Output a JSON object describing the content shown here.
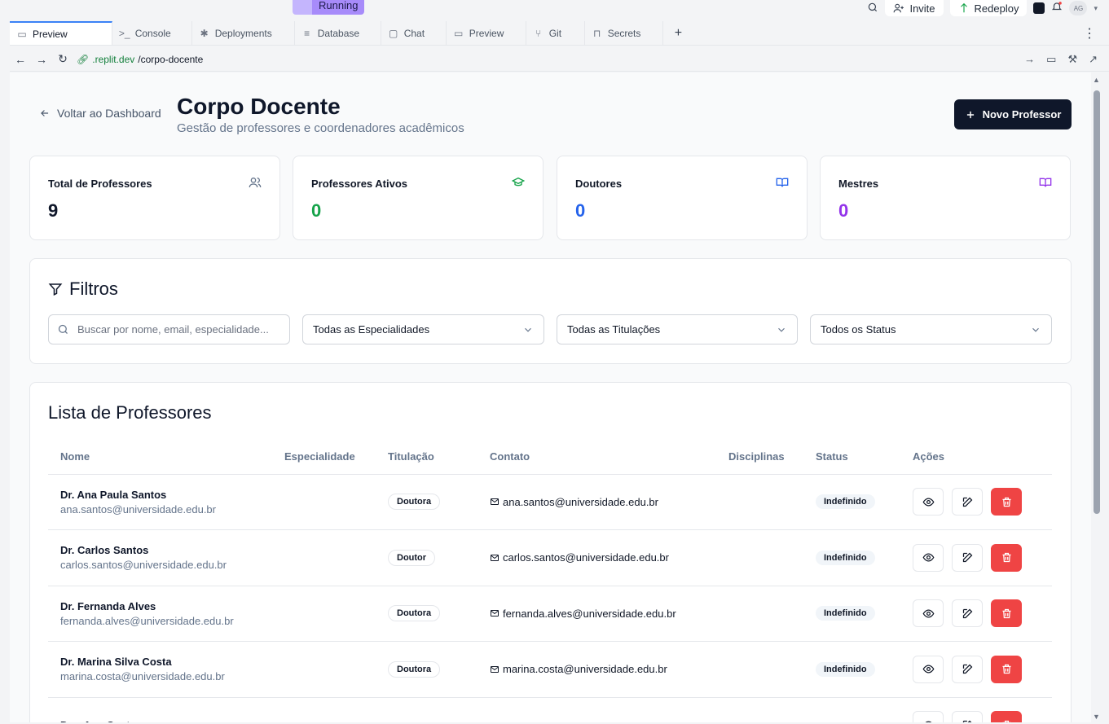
{
  "ide": {
    "status": "Running",
    "invite_label": "Invite",
    "redeploy_label": "Redeploy",
    "avatar_initials": "AG",
    "tabs": [
      {
        "label": "Preview",
        "icon": "monitor-icon",
        "active": true
      },
      {
        "label": "Console",
        "icon": "terminal-icon"
      },
      {
        "label": "Deployments",
        "icon": "deploy-icon"
      },
      {
        "label": "Database",
        "icon": "database-icon"
      },
      {
        "label": "Chat",
        "icon": "chat-icon"
      },
      {
        "label": "Preview",
        "icon": "monitor-icon"
      },
      {
        "label": "Git",
        "icon": "git-icon"
      },
      {
        "label": "Secrets",
        "icon": "lock-icon"
      }
    ],
    "url_host": ".replit.dev",
    "url_path": "/corpo-docente"
  },
  "page": {
    "back_label": "Voltar ao Dashboard",
    "title": "Corpo Docente",
    "subtitle": "Gestão de professores e coordenadores acadêmicos",
    "new_button": "Novo Professor"
  },
  "stats": [
    {
      "label": "Total de Professores",
      "value": "9",
      "color": "#0f172a",
      "icon": "users-icon",
      "icon_color": "#64748b"
    },
    {
      "label": "Professores Ativos",
      "value": "0",
      "color": "#16a34a",
      "icon": "graduation-cap-icon",
      "icon_color": "#16a34a"
    },
    {
      "label": "Doutores",
      "value": "0",
      "color": "#2563eb",
      "icon": "book-open-icon",
      "icon_color": "#2563eb"
    },
    {
      "label": "Mestres",
      "value": "0",
      "color": "#9333ea",
      "icon": "book-open-icon",
      "icon_color": "#9333ea"
    }
  ],
  "filters": {
    "title": "Filtros",
    "search_placeholder": "Buscar por nome, email, especialidade...",
    "specialty": "Todas as Especialidades",
    "titulation": "Todas as Titulações",
    "status": "Todos os Status"
  },
  "list": {
    "title": "Lista de Professores",
    "columns": [
      "Nome",
      "Especialidade",
      "Titulação",
      "Contato",
      "Disciplinas",
      "Status",
      "Ações"
    ],
    "rows": [
      {
        "name": "Dr. Ana Paula Santos",
        "email": "ana.santos@universidade.edu.br",
        "specialty": "",
        "titulation": "Doutora",
        "contact": "ana.santos@universidade.edu.br",
        "disciplines": "",
        "status": "Indefinido"
      },
      {
        "name": "Dr. Carlos Santos",
        "email": "carlos.santos@universidade.edu.br",
        "specialty": "",
        "titulation": "Doutor",
        "contact": "carlos.santos@universidade.edu.br",
        "disciplines": "",
        "status": "Indefinido"
      },
      {
        "name": "Dr. Fernanda Alves",
        "email": "fernanda.alves@universidade.edu.br",
        "specialty": "",
        "titulation": "Doutora",
        "contact": "fernanda.alves@universidade.edu.br",
        "disciplines": "",
        "status": "Indefinido"
      },
      {
        "name": "Dr. Marina Silva Costa",
        "email": "marina.costa@universidade.edu.br",
        "specialty": "",
        "titulation": "Doutora",
        "contact": "marina.costa@universidade.edu.br",
        "disciplines": "",
        "status": "Indefinido"
      },
      {
        "name": "Dra. Ana Costa",
        "email": "",
        "specialty": "",
        "titulation": "",
        "contact": "",
        "disciplines": "",
        "status": ""
      }
    ]
  }
}
